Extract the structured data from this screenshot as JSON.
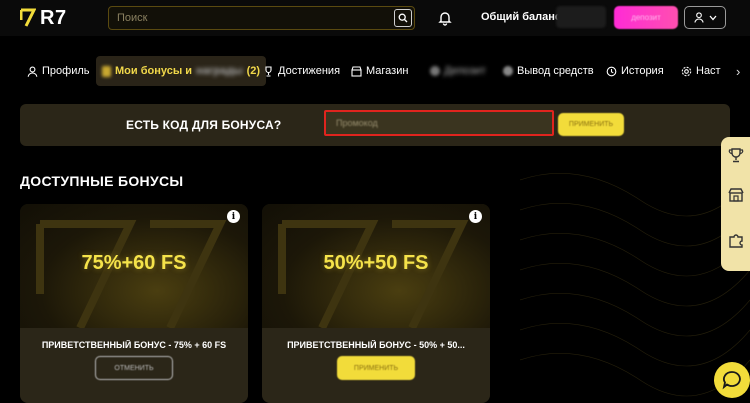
{
  "header": {
    "logo_text": "R7",
    "search_placeholder": "Поиск",
    "balance_label": "Общий баланс:",
    "deposit_label": "депозит"
  },
  "tabs": [
    {
      "label": "Профиль",
      "icon": "user-icon"
    },
    {
      "label": "Мои бонусы и",
      "icon": "gift-icon",
      "blurred_suffix": "награды",
      "count": "(2)"
    },
    {
      "label": "Достижения",
      "icon": "trophy-icon"
    },
    {
      "label": "Магазин",
      "icon": "shop-icon"
    },
    {
      "label": "Депозит",
      "icon": "wallet-icon"
    },
    {
      "label": "Вывод средств",
      "icon": "withdraw-icon"
    },
    {
      "label": "История",
      "icon": "history-icon"
    },
    {
      "label": "Наст",
      "icon": "settings-icon"
    }
  ],
  "bonus_code": {
    "title": "ЕСТЬ КОД ДЛЯ БОНУСА?",
    "placeholder": "Промокод",
    "apply_label": "ПРИМЕНИТЬ"
  },
  "section_title": "ДОСТУПНЫЕ БОНУСЫ",
  "cards": [
    {
      "headline": "75%+60 FS",
      "name": "ПРИВЕТСТВЕННЫЙ БОНУС - 75% + 60 FS",
      "button": "ОТМЕНИТЬ"
    },
    {
      "headline": "50%+50 FS",
      "name": "ПРИВЕТСТВЕННЫЙ БОНУС - 50% + 50...",
      "button": "ПРИМЕНИТЬ"
    }
  ],
  "colors": {
    "accent_yellow": "#f2dc3a",
    "highlight_red": "#e0241e",
    "deposit_pink": "#ff2bd6",
    "panel_bg": "#2b2618"
  }
}
